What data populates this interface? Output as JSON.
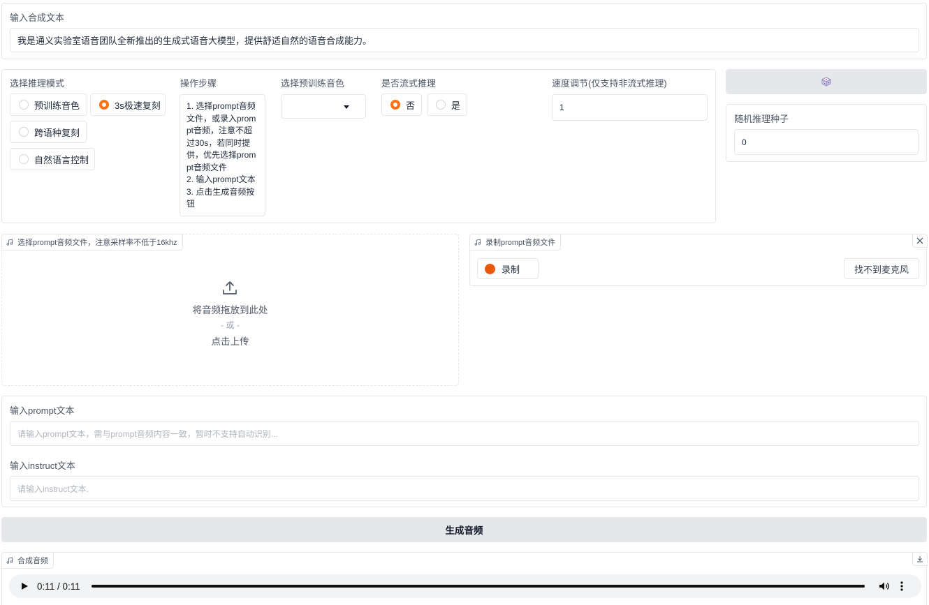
{
  "input_text": {
    "label": "输入合成文本",
    "value": "我是通义实验室语音团队全新推出的生成式语音大模型，提供舒适自然的语音合成能力。"
  },
  "mode": {
    "label": "选择推理模式",
    "options": [
      {
        "label": "预训练音色",
        "selected": false
      },
      {
        "label": "3s极速复刻",
        "selected": true
      },
      {
        "label": "跨语种复刻",
        "selected": false
      },
      {
        "label": "自然语言控制",
        "selected": false
      }
    ]
  },
  "steps": {
    "label": "操作步骤",
    "lines": [
      "1. 选择prompt音频文件，或录入prompt音频，注意不超过30s，若同时提供，优先选择prompt音频文件",
      "2. 输入prompt文本",
      "3. 点击生成音频按钮"
    ]
  },
  "voice": {
    "label": "选择预训练音色",
    "value": "",
    "icon": "caret-down-icon"
  },
  "stream": {
    "label": "是否流式推理",
    "options": [
      {
        "label": "否",
        "selected": true
      },
      {
        "label": "是",
        "selected": false
      }
    ]
  },
  "speed": {
    "label": "速度调节(仅支持非流式推理)",
    "value": "1"
  },
  "seed": {
    "button_icon": "dice-icon",
    "label": "随机推理种子",
    "value": "0"
  },
  "upload": {
    "tag": "选择prompt音频文件，注意采样率不低于16khz",
    "drop_text": "将音频拖放到此处",
    "or_text": "- 或 -",
    "click_text": "点击上传"
  },
  "record": {
    "tag": "录制prompt音频文件",
    "record_label": "录制",
    "mic_label": "找不到麦克风"
  },
  "prompt_text": {
    "label": "输入prompt文本",
    "placeholder": "请输入prompt文本，需与prompt音频内容一致，暂时不支持自动识别..."
  },
  "instruct_text": {
    "label": "输入instruct文本",
    "placeholder": "请输入instruct文本."
  },
  "generate": {
    "label": "生成音频"
  },
  "output": {
    "tag": "合成音频",
    "time": "0:11 / 0:11",
    "progress": 1.0
  },
  "colors": {
    "accent": "#f97316",
    "record": "#ea580c",
    "border": "#e5e7eb",
    "button_bg": "#e5e7eb"
  }
}
